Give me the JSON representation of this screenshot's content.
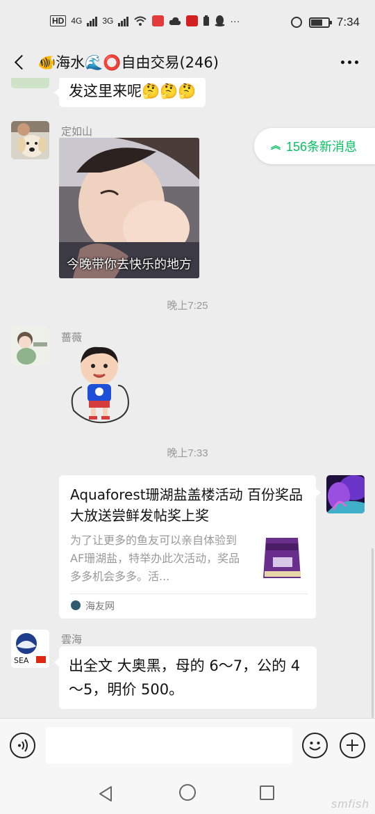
{
  "status_bar": {
    "left_badges": [
      "HD",
      "4G",
      "3G"
    ],
    "time": "7:34"
  },
  "header": {
    "title": "🐠海水🌊⭕自由交易(246)"
  },
  "new_messages_pill": {
    "label": "156条新消息"
  },
  "messages": {
    "m0": {
      "text": "发这里来呢🤔🤔🤔"
    },
    "m1": {
      "sender": "定如山",
      "gif_caption": "今晚带你去快乐的地方"
    },
    "t1": {
      "time": "晚上7:25"
    },
    "m2": {
      "sender": "蔷薇"
    },
    "t2": {
      "time": "晚上7:33"
    },
    "m3": {
      "title": "Aquaforest珊湖盐盖楼活动 百份奖品大放送尝鲜发帖奖上奖",
      "description": "为了让更多的鱼友可以亲自体验到AF珊湖盐，特举办此次活动，奖品多多机会多多。活...",
      "source": "海友网"
    },
    "m4": {
      "sender": "雲海",
      "text": "出全文  大奥黑，母的 6～7，公的 4～5，明价 500。"
    }
  },
  "watermark": {
    "text": "smfish"
  },
  "colors": {
    "accent_green": "#07c160",
    "bubble": "#ffffff",
    "background": "#ededed"
  }
}
